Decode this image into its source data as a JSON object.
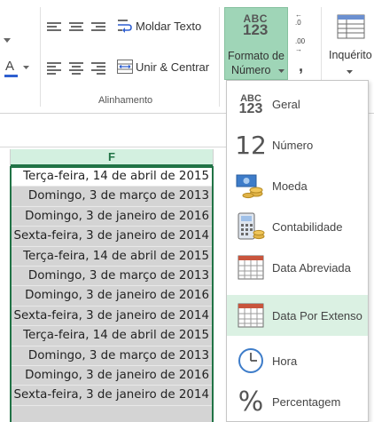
{
  "ribbon": {
    "wrap_text_label": "Moldar Texto",
    "merge_center_label": "Unir & Centrar",
    "alignment_group_label": "Alinhamento",
    "number_format_label_line1": "Formato de",
    "number_format_label_line2": "Número",
    "number_format_icon_top": "ABC",
    "number_format_icon_bottom": "123",
    "comma_label": ",",
    "styles_label": "Inquérito",
    "font_color_letter": "A",
    "accent_color": "#217346",
    "highlight_color": "#9fd5b7"
  },
  "sheet": {
    "column_header": "F",
    "cells": [
      "Terça-feira, 14 de abril de 2015",
      "Domingo, 3 de março de 2013",
      "Domingo, 3 de janeiro de 2016",
      "Sexta-feira, 3 de janeiro de 2014",
      "Terça-feira, 14 de abril de 2015",
      "Domingo, 3 de março de 2013",
      "Domingo, 3 de janeiro de 2016",
      "Sexta-feira, 3 de janeiro de 2014",
      "Terça-feira, 14 de abril de 2015",
      "Domingo, 3 de março de 2013",
      "Domingo, 3 de janeiro de 2016",
      "Sexta-feira, 3 de janeiro de 2014"
    ]
  },
  "dropdown": {
    "items": [
      {
        "label": "Geral",
        "icon": "abc-123-icon",
        "icon_text_top": "ABC",
        "icon_text_bottom": "123"
      },
      {
        "label": "Número",
        "icon": "number-12-icon",
        "icon_text": "12"
      },
      {
        "label": "Moeda",
        "icon": "currency-icon"
      },
      {
        "label": "Contabilidade",
        "icon": "accounting-icon"
      },
      {
        "label": "Data Abreviada",
        "icon": "short-date-calendar-icon"
      },
      {
        "label": "Data Por Extenso",
        "icon": "long-date-calendar-icon",
        "highlighted": true
      },
      {
        "label": "Hora",
        "icon": "clock-icon"
      },
      {
        "label": "Percentagem",
        "icon": "percent-icon",
        "icon_text": "%"
      }
    ]
  }
}
